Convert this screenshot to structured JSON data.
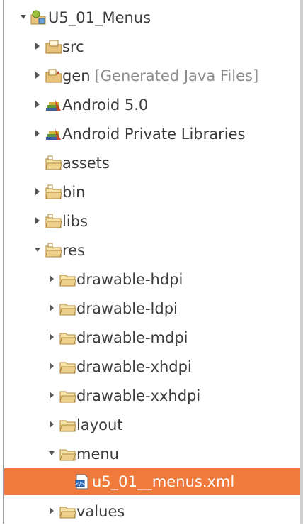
{
  "tree": {
    "project": {
      "label": "U5_01_Menus",
      "icon": "android-project-icon",
      "expanded": true
    },
    "items": [
      {
        "label": "src",
        "icon": "source-folder-icon",
        "expanded": false
      },
      {
        "label": "gen",
        "decoration": "[Generated Java Files]",
        "icon": "generated-source-folder-icon",
        "expanded": false
      },
      {
        "label": "Android 5.0",
        "icon": "library-container-icon",
        "expanded": false
      },
      {
        "label": "Android Private Libraries",
        "icon": "library-container-icon",
        "expanded": false
      },
      {
        "label": "assets",
        "icon": "folder-icon"
      },
      {
        "label": "bin",
        "icon": "folder-icon",
        "expanded": false
      },
      {
        "label": "libs",
        "icon": "folder-icon",
        "expanded": false
      },
      {
        "label": "res",
        "icon": "folder-icon",
        "expanded": true
      },
      {
        "label": "drawable-hdpi",
        "icon": "folder-icon",
        "expanded": false
      },
      {
        "label": "drawable-ldpi",
        "icon": "folder-icon",
        "expanded": false
      },
      {
        "label": "drawable-mdpi",
        "icon": "folder-icon",
        "expanded": false
      },
      {
        "label": "drawable-xhdpi",
        "icon": "folder-icon",
        "expanded": false
      },
      {
        "label": "drawable-xxhdpi",
        "icon": "folder-icon",
        "expanded": false
      },
      {
        "label": "layout",
        "icon": "folder-icon",
        "expanded": false
      },
      {
        "label": "menu",
        "icon": "folder-icon",
        "expanded": true
      },
      {
        "label": "u5_01__menus.xml",
        "icon": "xml-file-icon",
        "selected": true
      },
      {
        "label": "values",
        "icon": "folder-icon",
        "expanded": false
      }
    ]
  },
  "colors": {
    "selection": "#f07a3c",
    "text": "#3b3b3b",
    "decoration": "#8a8d8f",
    "folder": "#e8c27a"
  }
}
